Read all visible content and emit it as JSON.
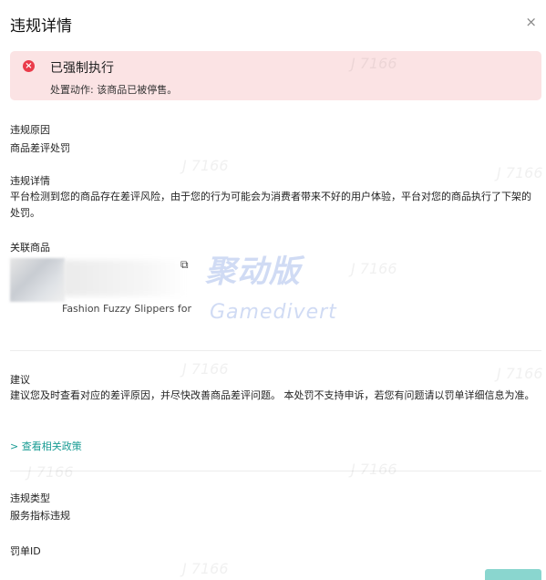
{
  "dialog": {
    "title": "违规详情",
    "close": "×"
  },
  "alert": {
    "icon": "×",
    "title": "已强制执行",
    "description": "处置动作: 该商品已被停售。"
  },
  "reason": {
    "label": "违规原因",
    "value": "商品差评处罚"
  },
  "details": {
    "label": "违规详情",
    "text": "平台检测到您的商品存在差评风险，由于您的行为可能会为消费者带来不好的用户体验，平台对您的商品执行了下架的处罚。"
  },
  "related": {
    "label": "关联商品",
    "product_name": "Fashion Fuzzy Slippers for",
    "copy_icon": "⧉"
  },
  "suggestion": {
    "label": "建议",
    "text": "建议您及时查看对应的差评原因，并尽快改善商品差评问题。 本处罚不支持申诉，若您有问题请以罚单详细信息为准。",
    "link": "> 查看相关政策"
  },
  "violation_type": {
    "label": "违规类型",
    "value": "服务指标违规"
  },
  "penalty_id": {
    "label": "罚单ID"
  },
  "watermark": {
    "main": "聚动版",
    "sub": "Gamedivert",
    "tag": "J 7166"
  },
  "colors": {
    "alert_bg": "#fbe3e4",
    "alert_icon": "#ea3b4a",
    "link": "#1a9c94"
  }
}
